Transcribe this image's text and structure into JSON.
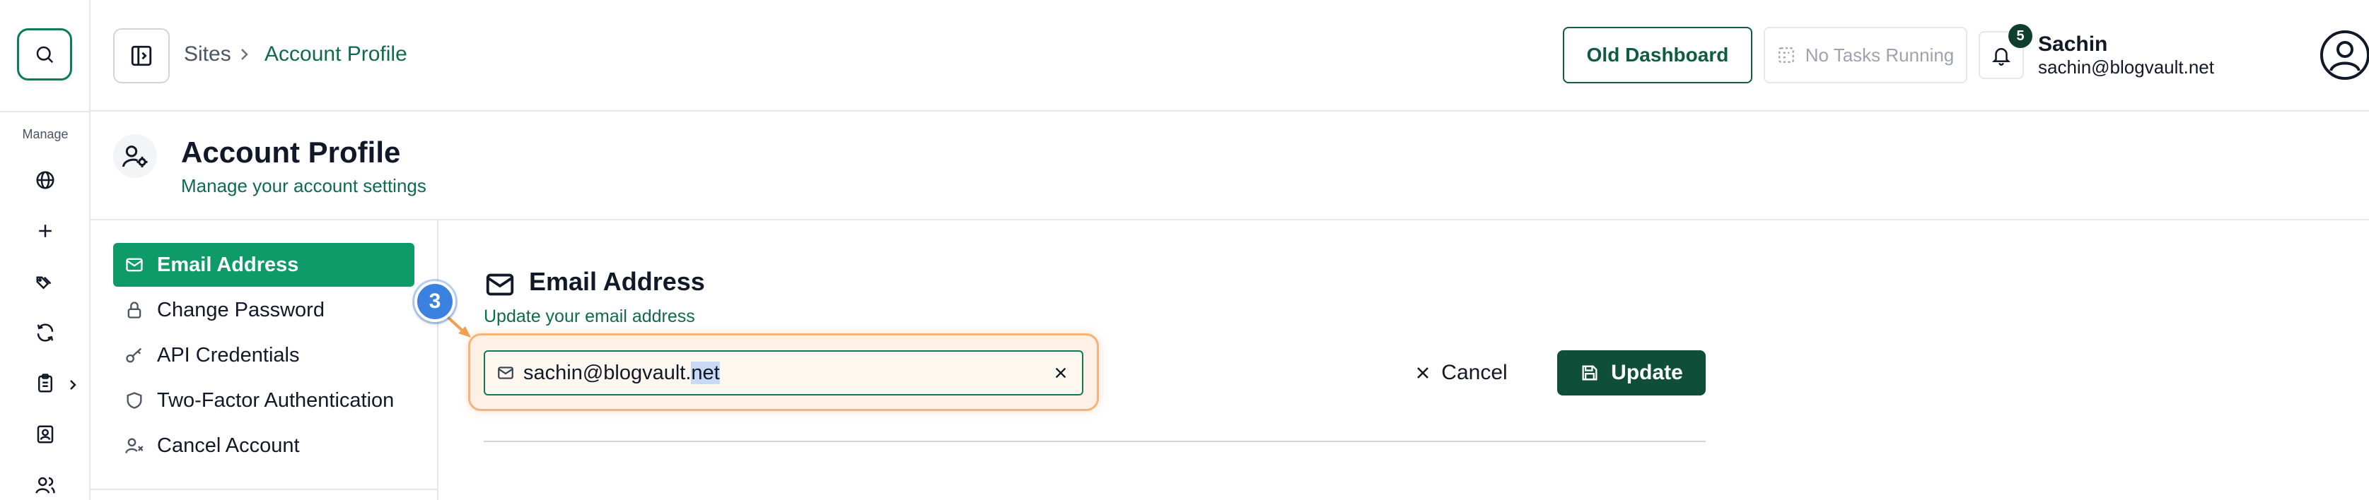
{
  "rail": {
    "section_label": "Manage",
    "icons": [
      "search-icon",
      "globe-icon",
      "plus-icon",
      "tags-icon",
      "refresh-icon",
      "clipboard-icon",
      "contact-book-icon",
      "users-icon"
    ]
  },
  "topbar": {
    "breadcrumb": {
      "root": "Sites",
      "current": "Account Profile"
    },
    "old_dashboard_label": "Old Dashboard",
    "tasks_label": "No Tasks Running",
    "notification_count": "5",
    "user_name": "Sachin",
    "user_email": "sachin@blogvault.net"
  },
  "page_header": {
    "title": "Account Profile",
    "subtitle": "Manage your account settings"
  },
  "settings_nav": {
    "items": [
      {
        "label": "Email Address",
        "icon": "mail-icon",
        "active": true
      },
      {
        "label": "Change Password",
        "icon": "lock-icon",
        "active": false
      },
      {
        "label": "API Credentials",
        "icon": "key-icon",
        "active": false
      },
      {
        "label": "Two-Factor Authentication",
        "icon": "shield-icon",
        "active": false
      },
      {
        "label": "Cancel Account",
        "icon": "user-x-icon",
        "active": false
      }
    ]
  },
  "section": {
    "title": "Email Address",
    "subtitle": "Update your email address",
    "email_value_prefix": "sachin@blogvault.",
    "email_value_selected": "net",
    "cancel_label": "Cancel",
    "update_label": "Update"
  },
  "annotation": {
    "step_number": "3"
  },
  "colors": {
    "brand_green": "#0f9a6a",
    "dark_green": "#0f4f39",
    "highlight_orange": "#f5b27a",
    "step_blue": "#3b82e0"
  }
}
